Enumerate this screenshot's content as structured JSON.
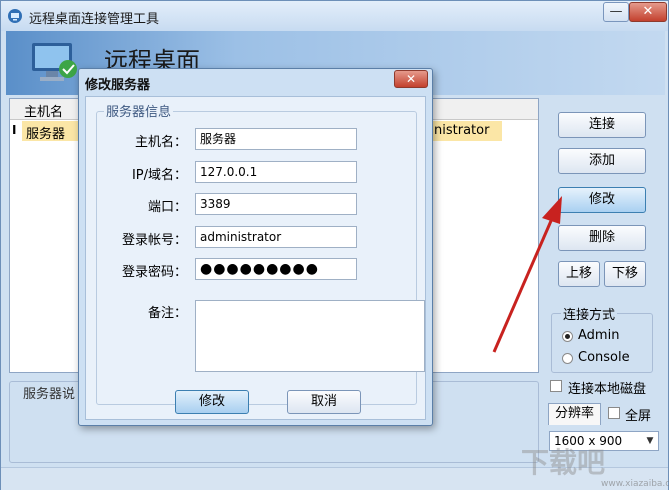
{
  "window": {
    "title": "远程桌面连接管理工具",
    "minimize": "—",
    "close": "✕"
  },
  "banner": {
    "text": "远程桌面"
  },
  "list": {
    "columns": [
      "主机名"
    ],
    "row_marker": "I",
    "rows": [
      {
        "host": "服务器",
        "user": "nistrator"
      }
    ]
  },
  "description_label": "服务器说",
  "actions": {
    "connect": "连接",
    "add": "添加",
    "edit": "修改",
    "delete": "删除",
    "move_up": "上移",
    "move_down": "下移"
  },
  "connection_mode": {
    "label": "连接方式",
    "options": [
      "Admin",
      "Console"
    ],
    "selected": "Admin"
  },
  "local_disk": {
    "label": "连接本地磁盘",
    "checked": false
  },
  "resolution": {
    "tab": "分辨率",
    "fullscreen_label": "全屏",
    "fullscreen_checked": false,
    "value": "1600 x 900"
  },
  "dialog": {
    "title": "修改服务器",
    "close": "✕",
    "group_label": "服务器信息",
    "fields": {
      "host_label": "主机名：",
      "host_value": "服务器",
      "ip_label": "IP/域名：",
      "ip_value": "127.0.0.1",
      "port_label": "端口：",
      "port_value": "3389",
      "account_label": "登录帐号：",
      "account_value": "administrator",
      "password_label": "登录密码：",
      "password_value": "●●●●●●●●●",
      "note_label": "备注：",
      "note_value": ""
    },
    "buttons": {
      "ok": "修改",
      "cancel": "取消"
    }
  },
  "watermark": {
    "text": "下载吧",
    "sub": "www.xiazaiba.com"
  },
  "colors": {
    "selection": "#fbe6a6",
    "annotation_arrow": "#c8221f",
    "accent": "#3c7fb1"
  }
}
